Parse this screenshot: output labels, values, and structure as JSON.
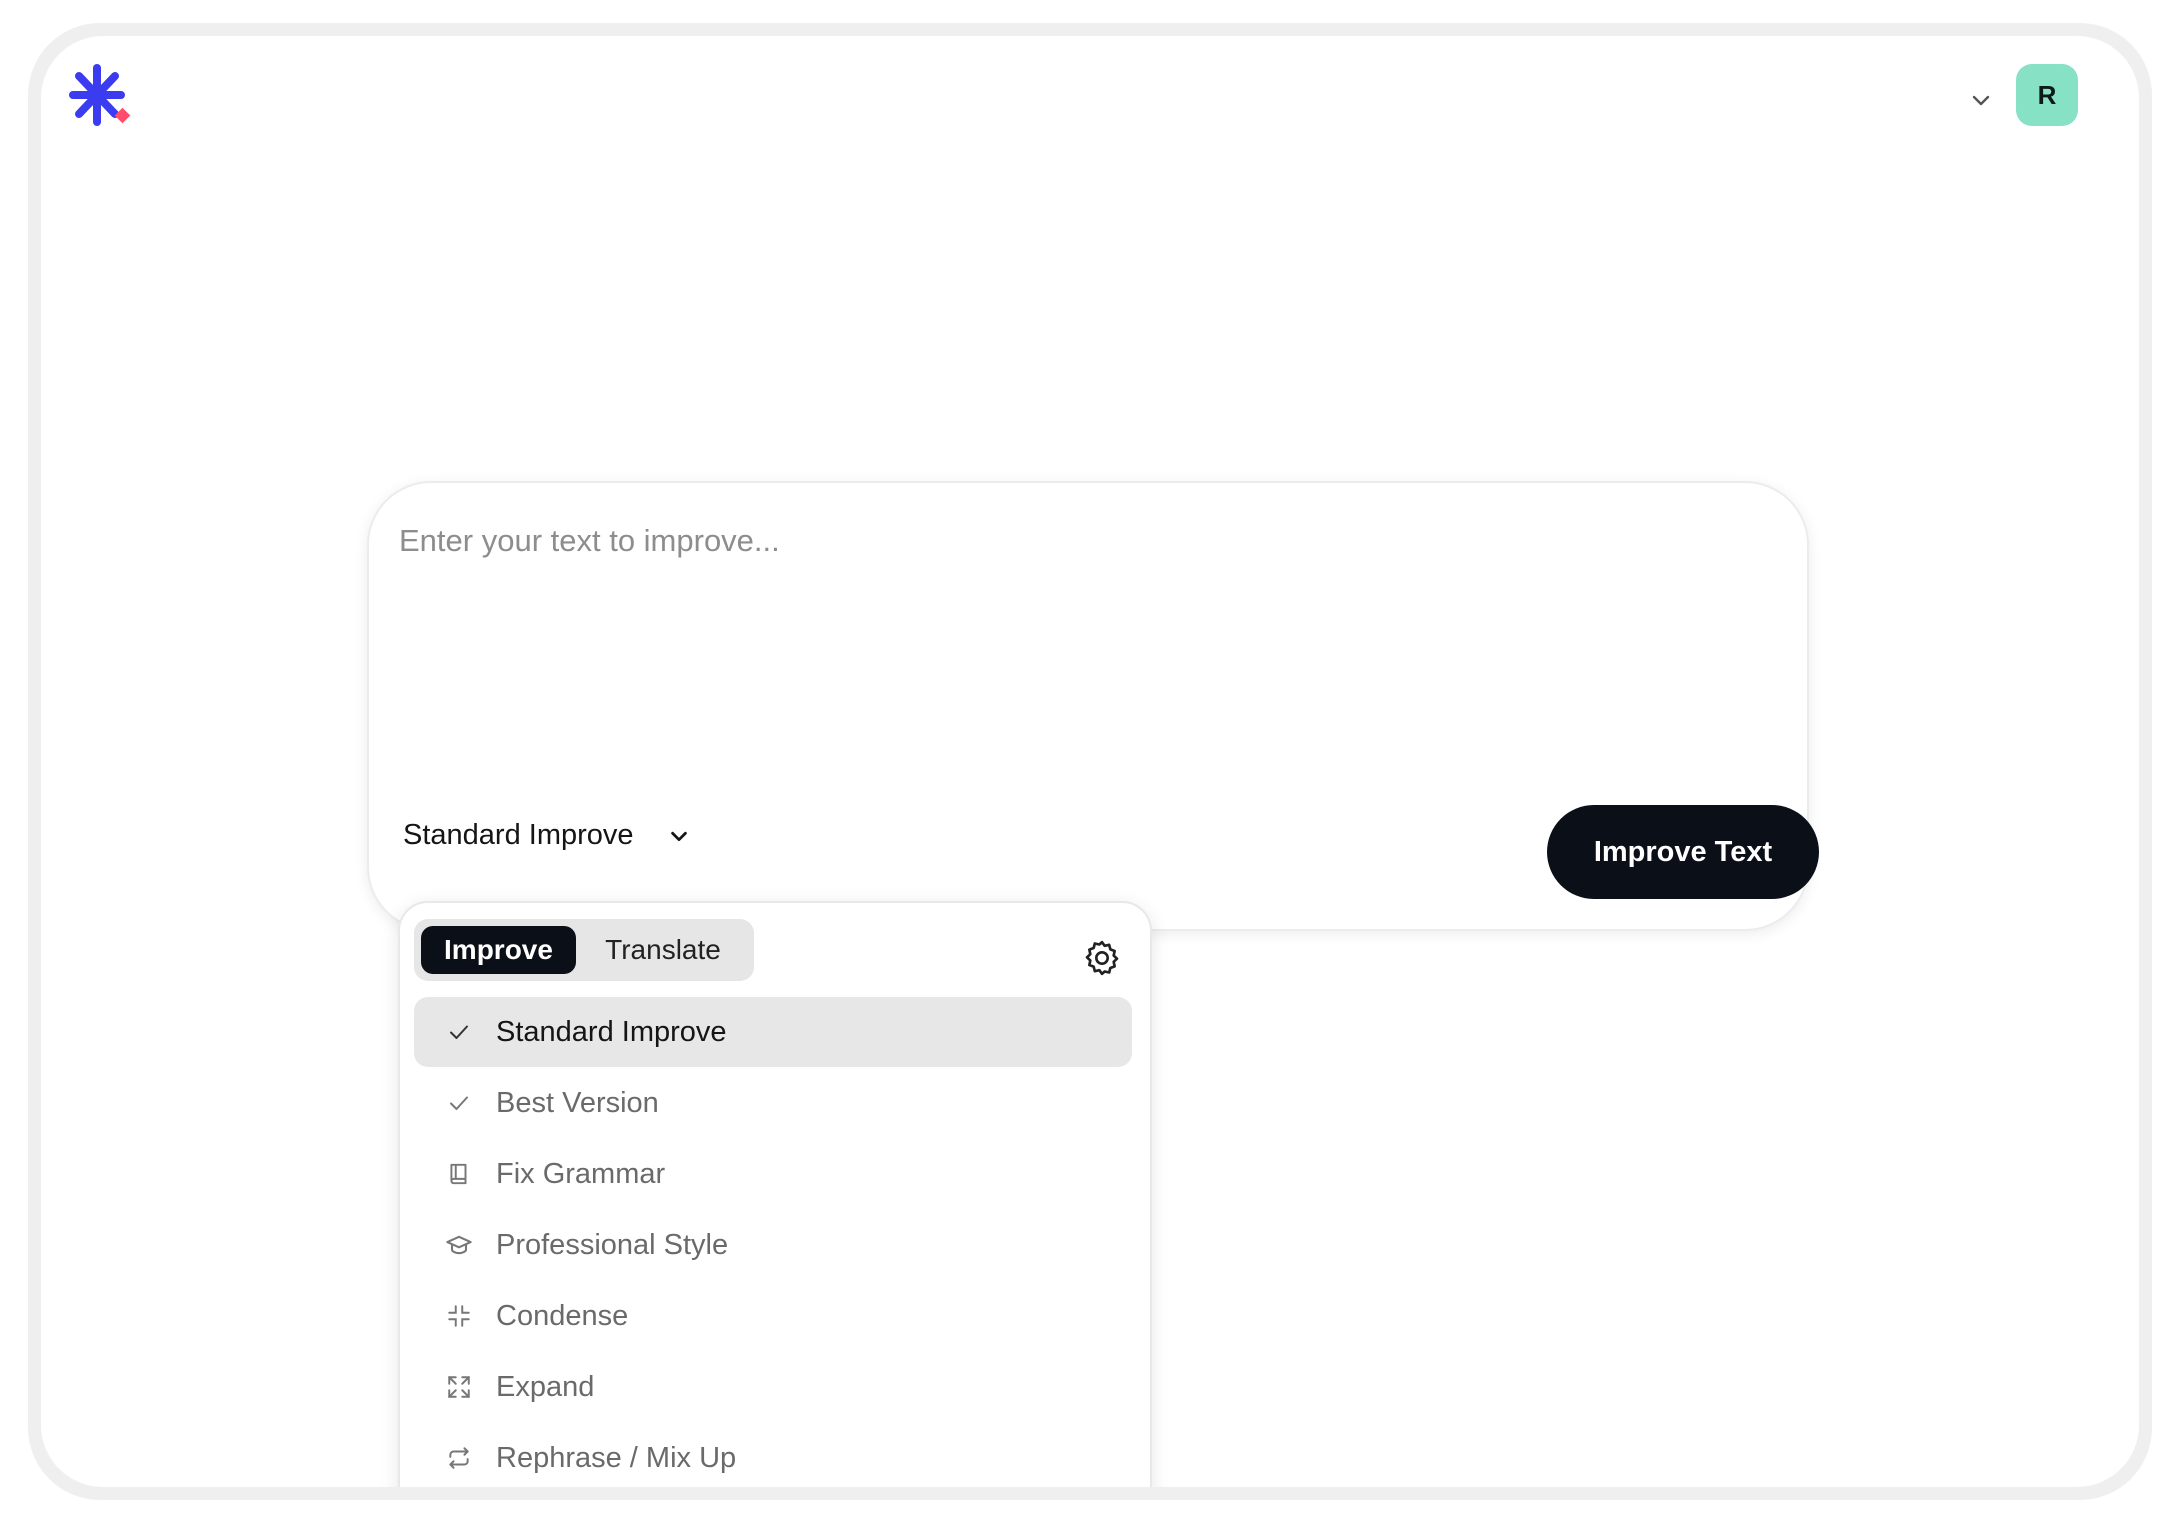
{
  "header": {
    "logo_icon": "asterisk-logo-icon",
    "account_menu_icon": "chevron-down-icon",
    "avatar_initial": "R",
    "colors": {
      "logo": "#3b3bf0",
      "logo_accent": "#ff4d6d",
      "avatar_bg": "#86e1c5"
    }
  },
  "editor": {
    "placeholder": "Enter your text to improve...",
    "mode_selected": "Standard Improve",
    "mode_chevron_icon": "chevron-down-icon",
    "submit_label": "Improve Text"
  },
  "dropdown": {
    "tabs": [
      {
        "label": "Improve",
        "active": true
      },
      {
        "label": "Translate",
        "active": false
      }
    ],
    "settings_icon": "gear-icon",
    "items": [
      {
        "label": "Standard Improve",
        "icon": "check-icon",
        "selected": true
      },
      {
        "label": "Best Version",
        "icon": "check-icon",
        "selected": false
      },
      {
        "label": "Fix Grammar",
        "icon": "book-icon",
        "selected": false
      },
      {
        "label": "Professional Style",
        "icon": "graduation-cap-icon",
        "selected": false
      },
      {
        "label": "Condense",
        "icon": "collapse-icon",
        "selected": false
      },
      {
        "label": "Expand",
        "icon": "expand-icon",
        "selected": false
      },
      {
        "label": "Rephrase / Mix Up",
        "icon": "repeat-icon",
        "selected": false
      }
    ]
  }
}
